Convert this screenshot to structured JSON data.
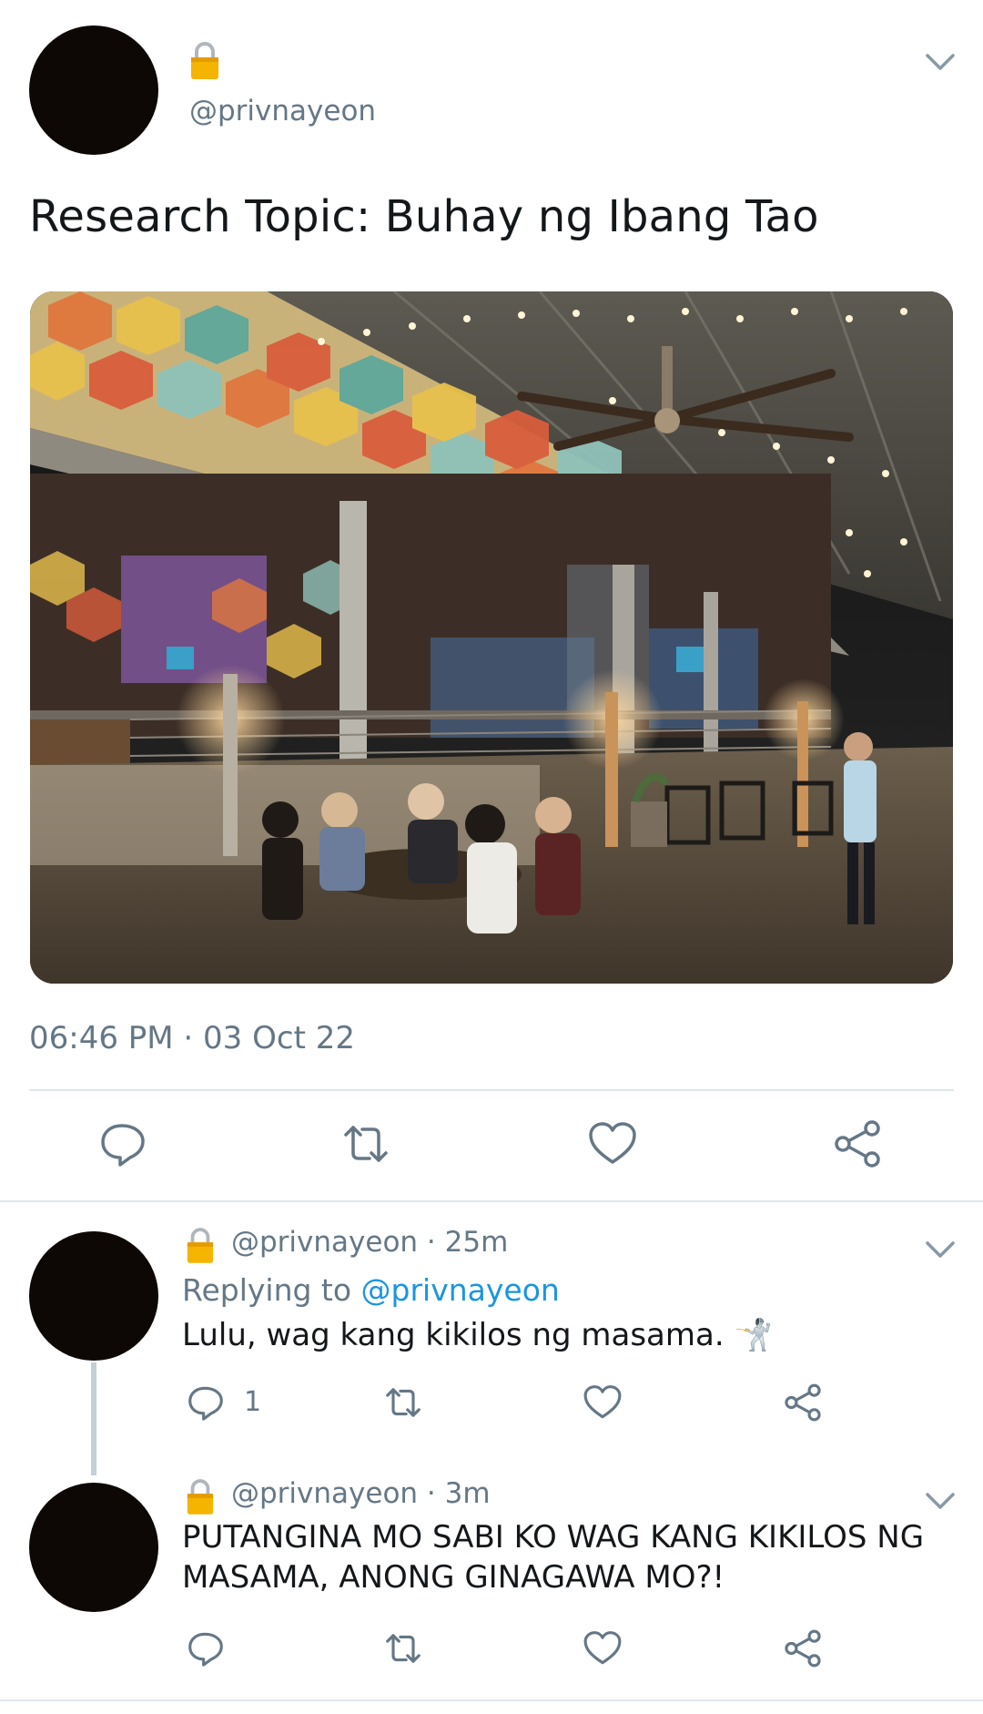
{
  "main_tweet": {
    "handle": "@privnayeon",
    "text": "Research Topic: Buhay ng Ibang Tao",
    "timestamp": "06:46 PM · 03 Oct 22",
    "icons": [
      "lock-icon",
      "chevron-down-icon",
      "reply-icon",
      "retweet-icon",
      "like-icon",
      "share-icon"
    ]
  },
  "replies": [
    {
      "handle": "@privnayeon",
      "time": "· 25m",
      "replying_label": "Replying to",
      "replying_to": "@privnayeon",
      "text": "Lulu, wag kang kikilos ng masama. 🤺",
      "reply_count": "1"
    },
    {
      "handle": "@privnayeon",
      "time": "· 3m",
      "text_line1": "PUTANGINA MO SABI KO WAG KANG KIKILOS NG",
      "text_line2": "MASAMA, ANONG GINAGAWA MO?!",
      "reply_count": ""
    }
  ],
  "colors": {
    "text": "#14171a",
    "secondary": "#657786",
    "link": "#1b95e0",
    "divider": "#e1e8ed",
    "lock_gold": "#f4b400"
  }
}
